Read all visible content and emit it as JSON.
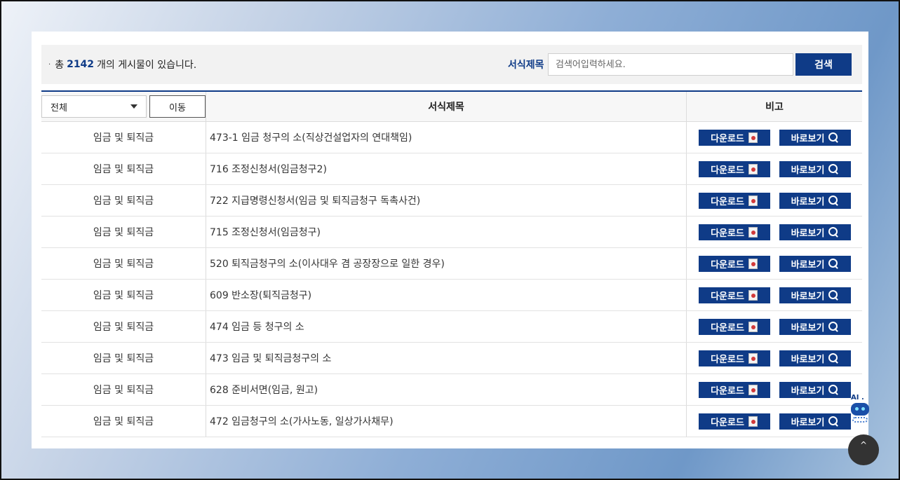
{
  "summary": {
    "bullet": "·",
    "prefix": "총",
    "count": "2142",
    "suffix": "개의 게시물이 있습니다."
  },
  "search": {
    "label": "서식제목",
    "placeholder": "검색어입력하세요.",
    "button": "검색"
  },
  "table": {
    "category_select": "전체",
    "move_button": "이동",
    "header_title": "서식제목",
    "header_note": "비고",
    "download_label": "다운로드",
    "view_label": "바로보기",
    "rows": [
      {
        "category": "임금 및 퇴직금",
        "title": "473-1 임금 청구의 소(직상건설업자의 연대책임)"
      },
      {
        "category": "임금 및 퇴직금",
        "title": "716 조정신청서(임금청구2)"
      },
      {
        "category": "임금 및 퇴직금",
        "title": "722 지급명령신청서(임금 및 퇴직금청구 독촉사건)"
      },
      {
        "category": "임금 및 퇴직금",
        "title": "715 조정신청서(임금청구)"
      },
      {
        "category": "임금 및 퇴직금",
        "title": "520 퇴직금청구의 소(이사대우 겸 공장장으로 일한 경우)"
      },
      {
        "category": "임금 및 퇴직금",
        "title": "609 반소장(퇴직금청구)"
      },
      {
        "category": "임금 및 퇴직금",
        "title": "474 임금 등 청구의 소"
      },
      {
        "category": "임금 및 퇴직금",
        "title": "473 임금 및 퇴직금청구의 소"
      },
      {
        "category": "임금 및 퇴직금",
        "title": "628 준비서면(임금, 원고)"
      },
      {
        "category": "임금 및 퇴직금",
        "title": "472 임금청구의 소(가사노동, 일상가사채무)"
      }
    ]
  },
  "widgets": {
    "ai_label": "AI .",
    "top_arrow": "^"
  },
  "colors": {
    "accent": "#0f3b87"
  }
}
